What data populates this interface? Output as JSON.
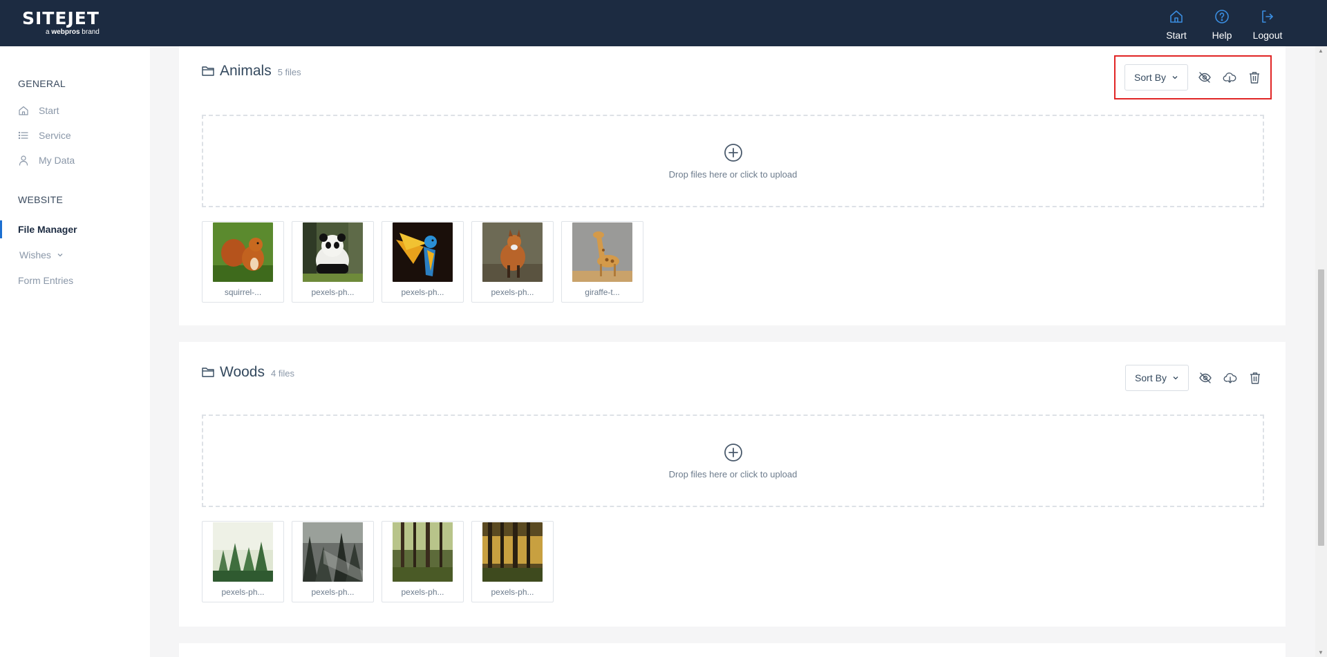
{
  "header": {
    "logo": "SITEJET",
    "logo_sub_prefix": "a",
    "logo_sub_brand": "webpros",
    "logo_sub_suffix": "brand",
    "nav": [
      {
        "label": "Start",
        "icon": "home-icon"
      },
      {
        "label": "Help",
        "icon": "help-icon"
      },
      {
        "label": "Logout",
        "icon": "logout-icon"
      }
    ]
  },
  "sidebar": {
    "general_title": "GENERAL",
    "general_items": [
      {
        "label": "Start",
        "icon": "home-icon"
      },
      {
        "label": "Service",
        "icon": "list-icon"
      },
      {
        "label": "My Data",
        "icon": "user-icon"
      }
    ],
    "website_title": "WEBSITE",
    "website_items": [
      {
        "label": "File Manager",
        "active": true
      },
      {
        "label": "Wishes",
        "icon": "chevron-down-icon"
      },
      {
        "label": "Form Entries"
      }
    ]
  },
  "folders": [
    {
      "name": "Animals",
      "count": "5 files",
      "sort_label": "Sort By",
      "dropzone_text": "Drop files here or click to upload",
      "files": [
        "squirrel-...",
        "pexels-ph...",
        "pexels-ph...",
        "pexels-ph...",
        "giraffe-t..."
      ]
    },
    {
      "name": "Woods",
      "count": "4 files",
      "sort_label": "Sort By",
      "dropzone_text": "Drop files here or click to upload",
      "files": [
        "pexels-ph...",
        "pexels-ph...",
        "pexels-ph...",
        "pexels-ph..."
      ]
    }
  ],
  "colors": {
    "header_bg": "#1c2b41",
    "accent": "#1c6fd1",
    "highlight": "#e02424"
  }
}
